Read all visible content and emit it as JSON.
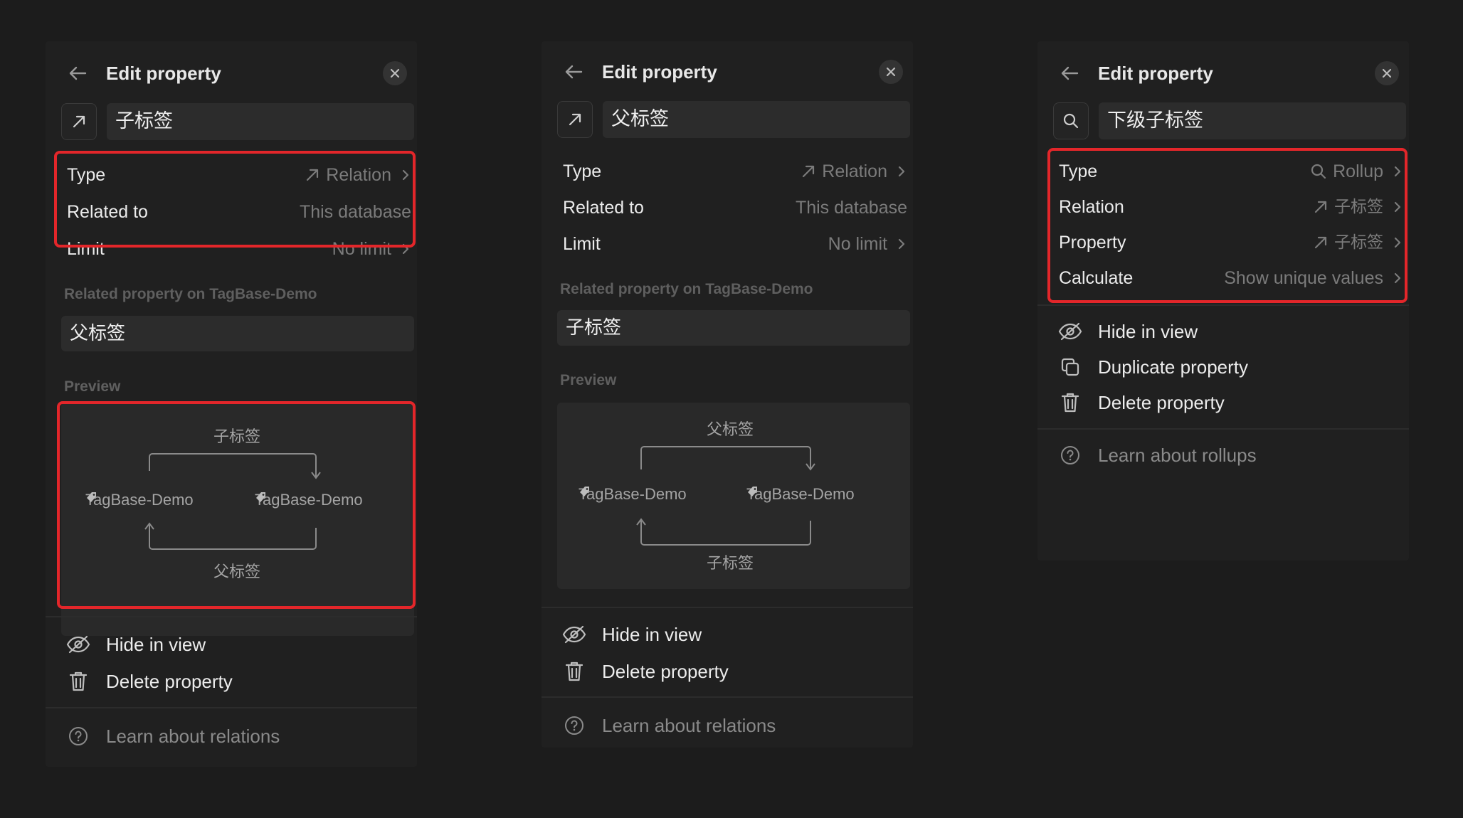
{
  "colors": {
    "background": "#1c1c1c",
    "panel": "#202020",
    "highlight": "#e3262a",
    "muted_text": "#7b7b7b"
  },
  "panels": [
    {
      "title": "Edit property",
      "type_icon": "relation-arrow-icon",
      "name": "子标签",
      "rows": [
        {
          "label": "Type",
          "icon": "relation-arrow-icon",
          "value": "Relation",
          "chevron": true
        },
        {
          "label": "Related to",
          "value": "This database",
          "chevron": false
        },
        {
          "label": "Limit",
          "value": "No limit",
          "chevron": true
        }
      ],
      "related_label": "Related property on TagBase-Demo",
      "related_value": "父标签",
      "preview_label": "Preview",
      "preview": {
        "top": "子标签",
        "bottom": "父标签",
        "left_db": "TagBase-Demo",
        "right_db": "TagBase-Demo"
      },
      "actions": [
        {
          "icon": "eye-slash-icon",
          "label": "Hide in view"
        },
        {
          "icon": "trash-icon",
          "label": "Delete property"
        }
      ],
      "help": {
        "icon": "help-circle-icon",
        "label": "Learn about relations"
      }
    },
    {
      "title": "Edit property",
      "type_icon": "relation-arrow-icon",
      "name": "父标签",
      "rows": [
        {
          "label": "Type",
          "icon": "relation-arrow-icon",
          "value": "Relation",
          "chevron": true
        },
        {
          "label": "Related to",
          "value": "This database",
          "chevron": false
        },
        {
          "label": "Limit",
          "value": "No limit",
          "chevron": true
        }
      ],
      "related_label": "Related property on TagBase-Demo",
      "related_value": "子标签",
      "preview_label": "Preview",
      "preview": {
        "top": "父标签",
        "bottom": "子标签",
        "left_db": "TagBase-Demo",
        "right_db": "TagBase-Demo"
      },
      "actions": [
        {
          "icon": "eye-slash-icon",
          "label": "Hide in view"
        },
        {
          "icon": "trash-icon",
          "label": "Delete property"
        }
      ],
      "help": {
        "icon": "help-circle-icon",
        "label": "Learn about relations"
      }
    },
    {
      "title": "Edit property",
      "type_icon": "search-icon",
      "name": "下级子标签",
      "rows": [
        {
          "label": "Type",
          "icon": "search-icon",
          "value": "Rollup",
          "chevron": true
        },
        {
          "label": "Relation",
          "icon": "relation-arrow-icon",
          "value": "子标签",
          "chevron": true
        },
        {
          "label": "Property",
          "icon": "relation-arrow-icon",
          "value": "子标签",
          "chevron": true
        },
        {
          "label": "Calculate",
          "value": "Show unique values",
          "chevron": true
        }
      ],
      "actions": [
        {
          "icon": "eye-slash-icon",
          "label": "Hide in view"
        },
        {
          "icon": "duplicate-icon",
          "label": "Duplicate property"
        },
        {
          "icon": "trash-icon",
          "label": "Delete property"
        }
      ],
      "help": {
        "icon": "help-circle-icon",
        "label": "Learn about rollups"
      }
    }
  ]
}
